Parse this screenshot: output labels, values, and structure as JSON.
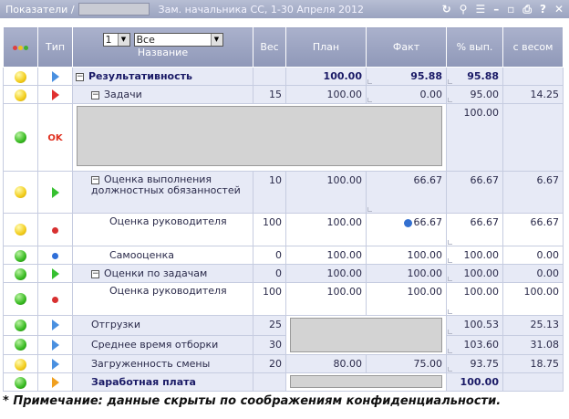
{
  "titlebar": {
    "label": "Показатели /",
    "title": "Зам. начальника СС, 1-30 Апреля 2012",
    "icons": [
      "refresh-icon",
      "search-icon",
      "list-icon",
      "minimize-icon",
      "restore-icon",
      "print-icon",
      "help-icon",
      "close-icon"
    ]
  },
  "header": {
    "col_type": "Тип",
    "level_select": "1",
    "filter_select": "Все",
    "col_name": "Название",
    "col_weight": "Вес",
    "col_plan": "План",
    "col_fact": "Факт",
    "col_pct": "% вып.",
    "col_weighted": "с весом"
  },
  "rows": [
    {
      "status": "yellow",
      "type": "tri-blue",
      "name": "Результативность",
      "bold": true,
      "expander": "⊟",
      "weight": "",
      "plan": "100.00",
      "fact": "95.88",
      "pct": "95.88",
      "weighted": ""
    },
    {
      "status": "yellow",
      "type": "tri-red",
      "name": "Задачи",
      "bold": false,
      "expander": "⊟",
      "weight": "15",
      "plan": "100.00",
      "fact": "0.00",
      "pct": "95.00",
      "weighted": "14.25"
    },
    {
      "status": "green",
      "type": "ok",
      "type_text": "OK",
      "name": "",
      "hidden": true,
      "weight": "",
      "plan": "",
      "fact": "",
      "pct": "100.00",
      "weighted": ""
    },
    {
      "status": "yellow",
      "type": "tri-green",
      "name": "Оценка выполнения должностных обязанностей",
      "bold": false,
      "expander": "⊟",
      "weight": "10",
      "plan": "100.00",
      "fact": "66.67",
      "pct": "66.67",
      "weighted": "6.67"
    },
    {
      "status": "yellow",
      "type": "dot-red",
      "name": "Оценка руководителя",
      "bold": false,
      "indent": true,
      "weight": "100",
      "plan": "100.00",
      "fact": "66.67",
      "fact_info": true,
      "pct": "66.67",
      "weighted": "66.67"
    },
    {
      "status": "green",
      "type": "dot-blue",
      "name": "Самооценка",
      "bold": false,
      "indent": true,
      "weight": "0",
      "plan": "100.00",
      "fact": "100.00",
      "pct": "100.00",
      "weighted": "0.00"
    },
    {
      "status": "green",
      "type": "tri-green",
      "name": "Оценки по задачам",
      "bold": false,
      "expander": "⊟",
      "weight": "0",
      "plan": "100.00",
      "fact": "100.00",
      "pct": "100.00",
      "weighted": "0.00"
    },
    {
      "status": "green",
      "type": "dot-red",
      "name": "Оценка руководителя",
      "bold": false,
      "indent": true,
      "weight": "100",
      "plan": "100.00",
      "fact": "100.00",
      "pct": "100.00",
      "weighted": "100.00"
    },
    {
      "status": "green",
      "type": "tri-blue",
      "name": "Отгрузки",
      "bold": false,
      "weight": "25",
      "plan": "",
      "fact": "",
      "pct": "100.53",
      "weighted": "25.13"
    },
    {
      "status": "green",
      "type": "tri-blue",
      "name": "Среднее время отборки",
      "bold": false,
      "weight": "30",
      "plan": "",
      "fact": "",
      "pct": "103.60",
      "weighted": "31.08"
    },
    {
      "status": "yellow",
      "type": "tri-blue",
      "name": "Загруженность смены",
      "bold": false,
      "weight": "20",
      "plan": "80.00",
      "fact": "75.00",
      "pct": "93.75",
      "weighted": "18.75"
    },
    {
      "status": "green",
      "type": "tri-orange",
      "name": "Заработная плата",
      "bold": true,
      "weight": "",
      "plan": "",
      "fact": "",
      "pct": "100.00",
      "weighted": ""
    }
  ],
  "footnote": "* Примечание: данные скрыты по соображениям конфиденциальности."
}
